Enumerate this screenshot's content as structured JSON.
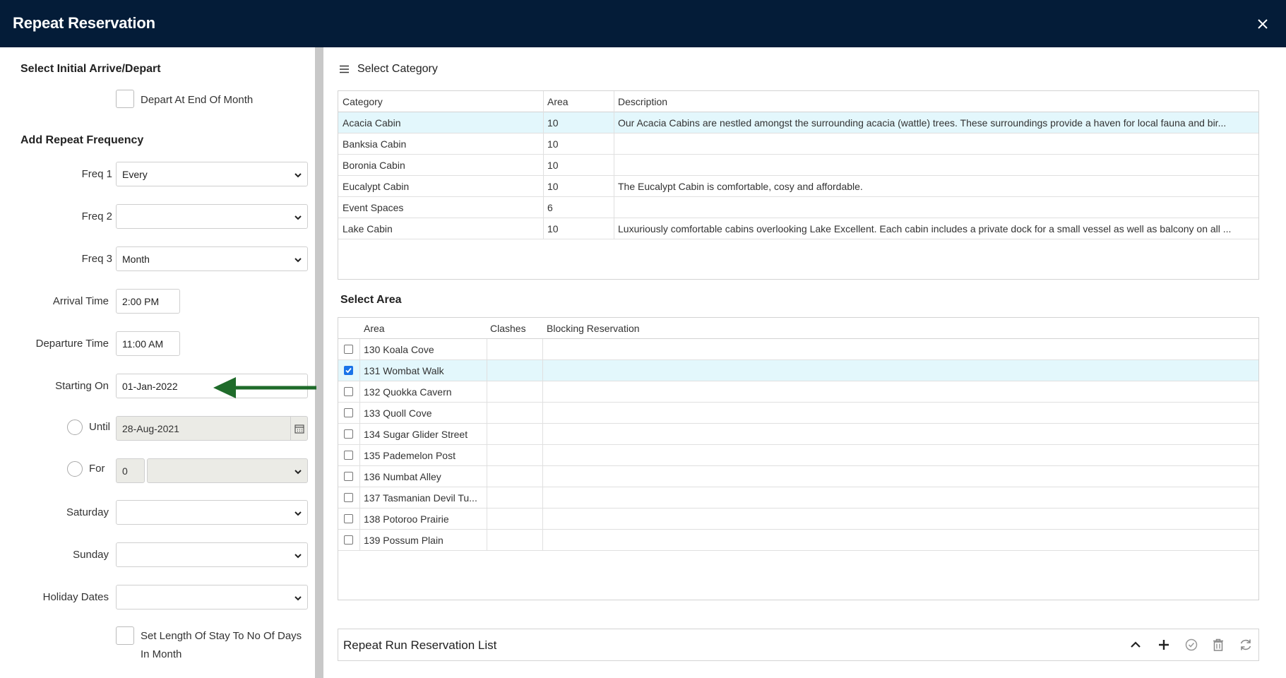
{
  "window": {
    "title": "Repeat Reservation"
  },
  "left": {
    "initial_section": "Select Initial Arrive/Depart",
    "depart_end_month_label": "Depart At End Of Month",
    "repeat_section": "Add Repeat Frequency",
    "freq1": {
      "label": "Freq 1",
      "value": "Every"
    },
    "freq2": {
      "label": "Freq 2",
      "value": ""
    },
    "freq3": {
      "label": "Freq 3",
      "value": "Month"
    },
    "arrival_time": {
      "label": "Arrival Time",
      "value": "2:00 PM"
    },
    "departure_time": {
      "label": "Departure Time",
      "value": "11:00 AM"
    },
    "starting_on": {
      "label": "Starting On",
      "value": "01-Jan-2022"
    },
    "until": {
      "label": "Until",
      "value": "28-Aug-2021"
    },
    "for": {
      "label": "For",
      "value": "0",
      "unit": ""
    },
    "saturday": {
      "label": "Saturday",
      "value": ""
    },
    "sunday": {
      "label": "Sunday",
      "value": ""
    },
    "holiday_dates": {
      "label": "Holiday Dates",
      "value": ""
    },
    "set_length_label_1": "Set Length Of Stay To No Of Days",
    "set_length_label_2": "In Month"
  },
  "category": {
    "heading": "Select Category",
    "columns": [
      "Category",
      "Area",
      "Description"
    ],
    "rows": [
      {
        "category": "Acacia Cabin",
        "area": "10",
        "description": "Our Acacia Cabins are nestled amongst the surrounding acacia (wattle) trees. These surroundings provide a haven for local fauna and bir...",
        "selected": true
      },
      {
        "category": "Banksia Cabin",
        "area": "10",
        "description": "",
        "selected": false
      },
      {
        "category": "Boronia Cabin",
        "area": "10",
        "description": "",
        "selected": false
      },
      {
        "category": "Eucalypt Cabin",
        "area": "10",
        "description": "The Eucalypt Cabin is comfortable, cosy and affordable.",
        "selected": false
      },
      {
        "category": "Event Spaces",
        "area": "6",
        "description": "",
        "selected": false
      },
      {
        "category": "Lake Cabin",
        "area": "10",
        "description": "Luxuriously comfortable cabins overlooking Lake Excellent. Each cabin includes a private dock for a small vessel as well as balcony on all ...",
        "selected": false
      }
    ]
  },
  "area": {
    "heading": "Select Area",
    "columns": [
      "Area",
      "Clashes",
      "Blocking Reservation"
    ],
    "rows": [
      {
        "area": "130 Koala Cove",
        "checked": false
      },
      {
        "area": "131 Wombat Walk",
        "checked": true
      },
      {
        "area": "132 Quokka Cavern",
        "checked": false
      },
      {
        "area": "133 Quoll Cove",
        "checked": false
      },
      {
        "area": "134 Sugar Glider Street",
        "checked": false
      },
      {
        "area": "135 Pademelon Post",
        "checked": false
      },
      {
        "area": "136 Numbat Alley",
        "checked": false
      },
      {
        "area": "137 Tasmanian Devil Tu...",
        "checked": false
      },
      {
        "area": "138 Potoroo Prairie",
        "checked": false
      },
      {
        "area": "139 Possum Plain",
        "checked": false
      }
    ]
  },
  "run_list": {
    "title": "Repeat Run Reservation List",
    "icons": [
      "chevron-up-icon",
      "plus-icon",
      "check-circle-icon",
      "trash-icon",
      "refresh-icon"
    ]
  },
  "colors": {
    "header_bg": "#041c38",
    "selected_row": "#e3f7fc",
    "arrow": "#1f6b2a"
  }
}
